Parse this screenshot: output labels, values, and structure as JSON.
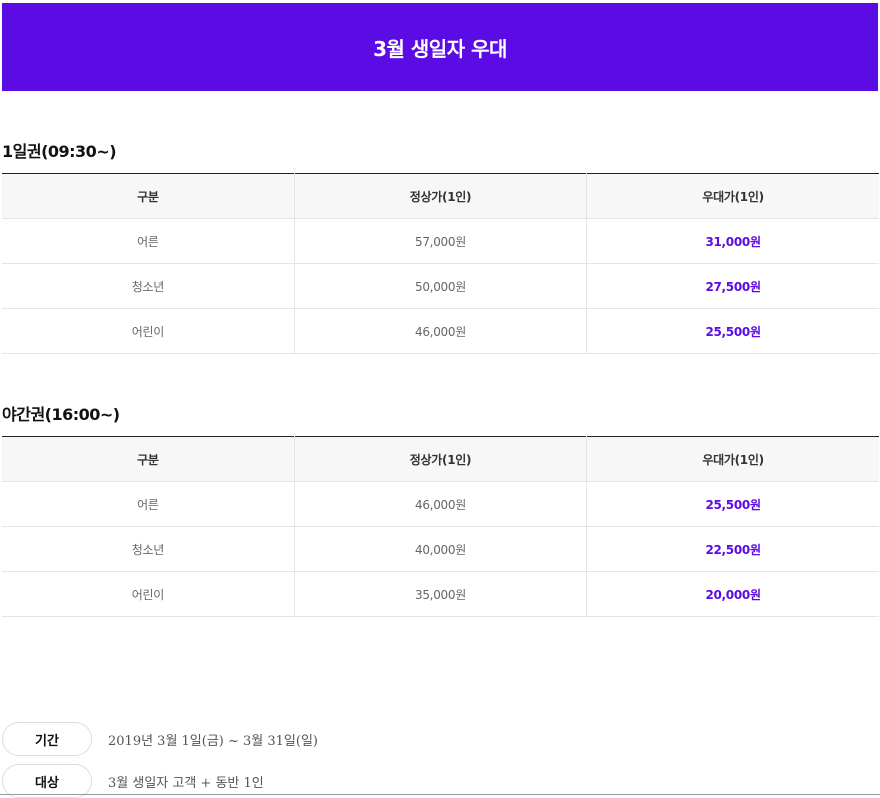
{
  "banner": {
    "title": "3월 생일자 우대"
  },
  "sections": [
    {
      "title": "1일권(09:30~)",
      "headers": [
        "구분",
        "정상가(1인)",
        "우대가(1인)"
      ],
      "rows": [
        {
          "category": "어른",
          "regular": "57,000원",
          "discount": "31,000원"
        },
        {
          "category": "청소년",
          "regular": "50,000원",
          "discount": "27,500원"
        },
        {
          "category": "어린이",
          "regular": "46,000원",
          "discount": "25,500원"
        }
      ]
    },
    {
      "title": "야간권(16:00~)",
      "headers": [
        "구분",
        "정상가(1인)",
        "우대가(1인)"
      ],
      "rows": [
        {
          "category": "어른",
          "regular": "46,000원",
          "discount": "25,500원"
        },
        {
          "category": "청소년",
          "regular": "40,000원",
          "discount": "22,500원"
        },
        {
          "category": "어린이",
          "regular": "35,000원",
          "discount": "20,000원"
        }
      ]
    }
  ],
  "info": [
    {
      "label": "기간",
      "text": "2019년 3월 1일(금) ~ 3월 31일(일)"
    },
    {
      "label": "대상",
      "text": "3월 생일자 고객 + 동반 1인"
    }
  ],
  "colors": {
    "accent": "#5b0be3"
  }
}
